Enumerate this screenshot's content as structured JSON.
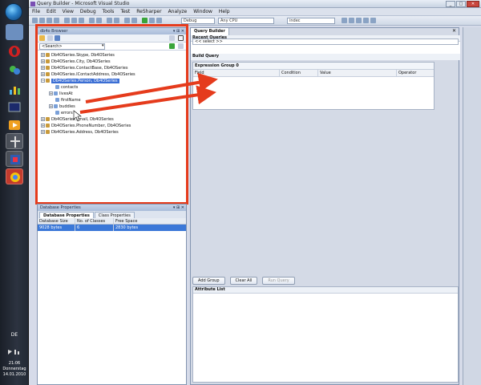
{
  "window": {
    "title": "Query Builder - Microsoft Visual Studio"
  },
  "menu": [
    "File",
    "Edit",
    "View",
    "Debug",
    "Tools",
    "Test",
    "ReSharper",
    "Analyze",
    "Window",
    "Help"
  ],
  "toolbar": {
    "config": "Debug",
    "platform": "Any CPU",
    "find": "indec"
  },
  "db4o_browser": {
    "title": "db4o Browser",
    "search_placeholder": "<Search>",
    "tree": [
      "Db4OSeries.Skype, Db4OSeries",
      "Db4OSeries.City, Db4OSeries",
      "Db4OSeries.ContactBase, Db4OSeries",
      "Db4OSeries.IContactAddress, Db4OSeries",
      "Db4OSeries.Person, Db4OSeries"
    ],
    "children": [
      "contacts",
      "livesAt",
      "firstName",
      "buddies",
      "errors"
    ],
    "tree_after": [
      "Db4OSeries.Email, Db4OSeries",
      "Db4OSeries.PhoneNumber, Db4OSeries",
      "Db4OSeries.Address, Db4OSeries"
    ]
  },
  "db_props": {
    "title": "Database Properties",
    "tabs": [
      "Database Properties",
      "Class Properties"
    ],
    "columns": [
      "Database Size",
      "No. of Classes",
      "Free Space"
    ],
    "row": [
      "9028 bytes",
      "6",
      "2830 bytes"
    ]
  },
  "query_builder": {
    "tab": "Query Builder",
    "recent_label": "Recent Queries",
    "select_placeholder": "<< select >>",
    "build_label": "Build Query",
    "group_title": "Expression Group 0",
    "columns": [
      "Field",
      "Condition",
      "Value",
      "Operator"
    ],
    "buttons": {
      "add_group": "Add Group",
      "clear_all": "Clear All",
      "run_query": "Run Query"
    },
    "attr_label": "Attribute List"
  },
  "taskbar": {
    "lang": "DE",
    "time": "21:06",
    "day": "Donnerstag",
    "date": "14.01.2010"
  },
  "colors": {
    "highlight": "#e53b1c",
    "selection": "#3b6ed4"
  }
}
